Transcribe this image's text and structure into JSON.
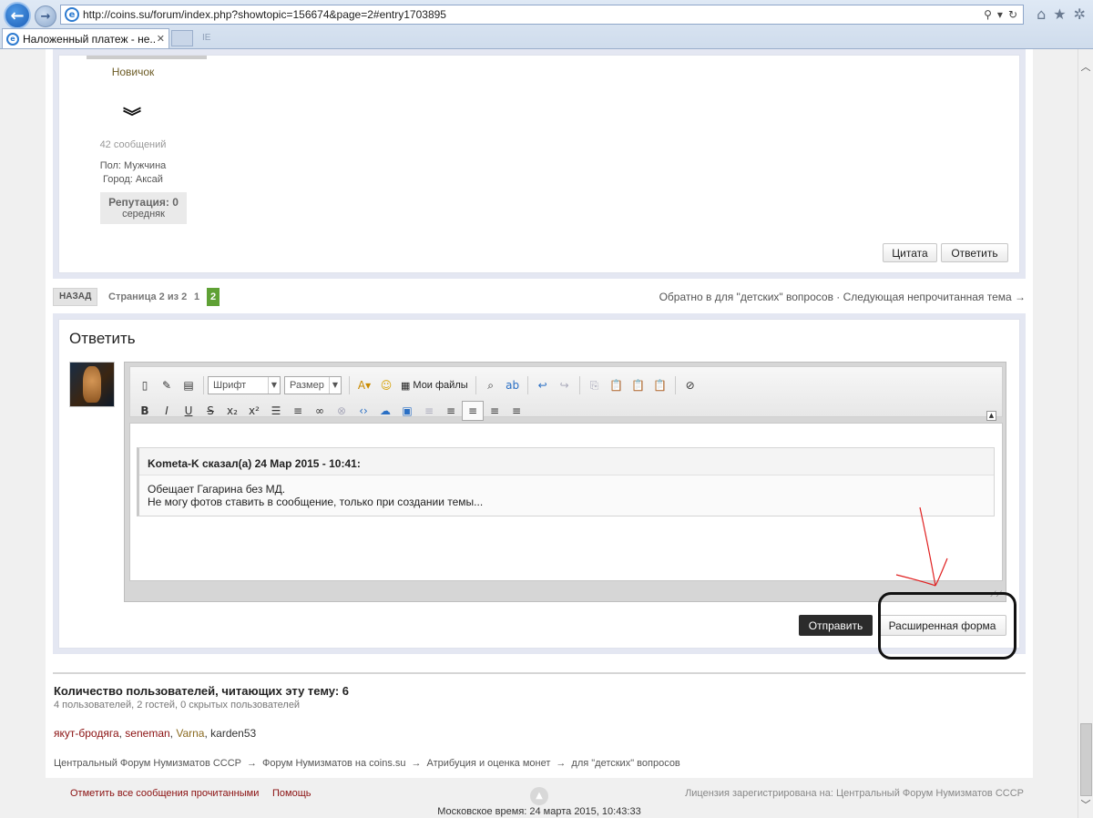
{
  "browser": {
    "url": "http://coins.su/forum/index.php?showtopic=156674&page=2#entry1703895",
    "tab_title": "Наложенный платеж - не...",
    "tab_close": "✕",
    "ghost_tab": "IE",
    "back_glyph": "←",
    "forward_glyph": "→",
    "addr_search": "⚲",
    "addr_dropdown": "▾",
    "addr_refresh": "↻",
    "home_icon": "⌂",
    "star_icon": "★",
    "settings_icon": "✲"
  },
  "author": {
    "rank": "Новичок",
    "posts": "42 сообщений",
    "gender": "Пол: Мужчина",
    "city": "Город: Аксай",
    "reputation": "Репутация: 0",
    "reputation_level": "середняк"
  },
  "post_buttons": {
    "quote": "Цитата",
    "reply": "Ответить"
  },
  "pager": {
    "back": "НАЗАД",
    "page_of": "Страница 2 из 2",
    "page1": "1",
    "page2": "2",
    "right": "Обратно в для \"детских\" вопросов · Следующая непрочитанная тема →"
  },
  "reply": {
    "title": "Ответить",
    "font_select": "Шрифт",
    "size_select": "Размер",
    "my_files": "Мои файлы",
    "quote_header": "Kometa-K сказал(а) 24 Мар 2015 - 10:41:",
    "quote_line1": "Обещает Гагарина без МД.",
    "quote_line2": "Не могу фотов ставить в сообщение, только при создании темы...",
    "submit": "Отправить",
    "advanced": "Расширенная форма"
  },
  "toolbar_row1": [
    "▯",
    "✎",
    "▤"
  ],
  "toolbar_row1b": [
    "A▾",
    "☺"
  ],
  "toolbar_row1c": [
    "⌕",
    "ab",
    "↩",
    "↪",
    "⎘",
    "📋",
    "📋",
    "📋",
    "⊘"
  ],
  "toolbar_row2": [
    "B",
    "I",
    "U",
    "S",
    "x₂",
    "x²",
    "☰",
    "≡",
    "∞",
    "⊗",
    "‹›",
    "☁",
    "▣",
    "≡",
    "≡",
    "≡",
    "≡",
    "≡"
  ],
  "readers": {
    "title": "Количество пользователей, читающих эту тему: 6",
    "sub": "4 пользователей, 2 гостей, 0 скрытых пользователей",
    "users": [
      "якут-бродяга",
      "seneman",
      "Varna",
      "karden53"
    ],
    "separator": ", "
  },
  "breadcrumb": [
    "Центральный Форум Нумизматов СССР",
    "Форум Нумизматов на coins.su",
    "Атрибуция и оценка монет",
    "для \"детских\" вопросов"
  ],
  "breadcrumb_arrow": "→",
  "footer": {
    "mark_read": "Отметить все сообщения прочитанными",
    "help": "Помощь",
    "license": "Лицензия зарегистрирована на: Центральный Форум Нумизматов СССР",
    "time": "Московское время: 24 марта 2015, 10:43:33"
  },
  "colors": {
    "accent_green": "#5fa135",
    "link_red": "#8a1010",
    "annotation_red": "#e02020"
  }
}
